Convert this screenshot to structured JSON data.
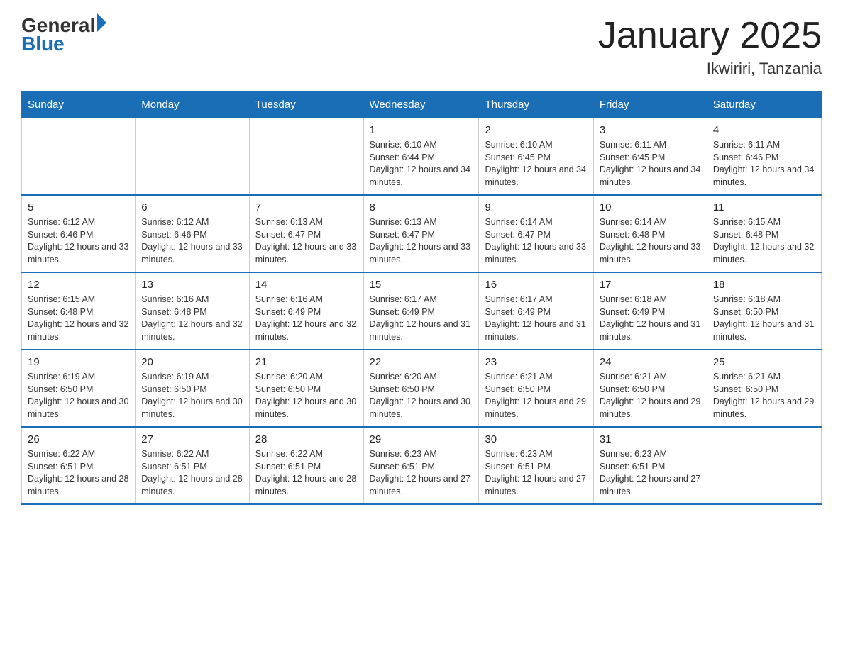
{
  "header": {
    "logo": {
      "general": "General",
      "blue": "Blue"
    },
    "title": "January 2025",
    "subtitle": "Ikwiriri, Tanzania"
  },
  "weekdays": [
    "Sunday",
    "Monday",
    "Tuesday",
    "Wednesday",
    "Thursday",
    "Friday",
    "Saturday"
  ],
  "weeks": [
    [
      {
        "day": "",
        "info": ""
      },
      {
        "day": "",
        "info": ""
      },
      {
        "day": "",
        "info": ""
      },
      {
        "day": "1",
        "info": "Sunrise: 6:10 AM\nSunset: 6:44 PM\nDaylight: 12 hours and 34 minutes."
      },
      {
        "day": "2",
        "info": "Sunrise: 6:10 AM\nSunset: 6:45 PM\nDaylight: 12 hours and 34 minutes."
      },
      {
        "day": "3",
        "info": "Sunrise: 6:11 AM\nSunset: 6:45 PM\nDaylight: 12 hours and 34 minutes."
      },
      {
        "day": "4",
        "info": "Sunrise: 6:11 AM\nSunset: 6:46 PM\nDaylight: 12 hours and 34 minutes."
      }
    ],
    [
      {
        "day": "5",
        "info": "Sunrise: 6:12 AM\nSunset: 6:46 PM\nDaylight: 12 hours and 33 minutes."
      },
      {
        "day": "6",
        "info": "Sunrise: 6:12 AM\nSunset: 6:46 PM\nDaylight: 12 hours and 33 minutes."
      },
      {
        "day": "7",
        "info": "Sunrise: 6:13 AM\nSunset: 6:47 PM\nDaylight: 12 hours and 33 minutes."
      },
      {
        "day": "8",
        "info": "Sunrise: 6:13 AM\nSunset: 6:47 PM\nDaylight: 12 hours and 33 minutes."
      },
      {
        "day": "9",
        "info": "Sunrise: 6:14 AM\nSunset: 6:47 PM\nDaylight: 12 hours and 33 minutes."
      },
      {
        "day": "10",
        "info": "Sunrise: 6:14 AM\nSunset: 6:48 PM\nDaylight: 12 hours and 33 minutes."
      },
      {
        "day": "11",
        "info": "Sunrise: 6:15 AM\nSunset: 6:48 PM\nDaylight: 12 hours and 32 minutes."
      }
    ],
    [
      {
        "day": "12",
        "info": "Sunrise: 6:15 AM\nSunset: 6:48 PM\nDaylight: 12 hours and 32 minutes."
      },
      {
        "day": "13",
        "info": "Sunrise: 6:16 AM\nSunset: 6:48 PM\nDaylight: 12 hours and 32 minutes."
      },
      {
        "day": "14",
        "info": "Sunrise: 6:16 AM\nSunset: 6:49 PM\nDaylight: 12 hours and 32 minutes."
      },
      {
        "day": "15",
        "info": "Sunrise: 6:17 AM\nSunset: 6:49 PM\nDaylight: 12 hours and 31 minutes."
      },
      {
        "day": "16",
        "info": "Sunrise: 6:17 AM\nSunset: 6:49 PM\nDaylight: 12 hours and 31 minutes."
      },
      {
        "day": "17",
        "info": "Sunrise: 6:18 AM\nSunset: 6:49 PM\nDaylight: 12 hours and 31 minutes."
      },
      {
        "day": "18",
        "info": "Sunrise: 6:18 AM\nSunset: 6:50 PM\nDaylight: 12 hours and 31 minutes."
      }
    ],
    [
      {
        "day": "19",
        "info": "Sunrise: 6:19 AM\nSunset: 6:50 PM\nDaylight: 12 hours and 30 minutes."
      },
      {
        "day": "20",
        "info": "Sunrise: 6:19 AM\nSunset: 6:50 PM\nDaylight: 12 hours and 30 minutes."
      },
      {
        "day": "21",
        "info": "Sunrise: 6:20 AM\nSunset: 6:50 PM\nDaylight: 12 hours and 30 minutes."
      },
      {
        "day": "22",
        "info": "Sunrise: 6:20 AM\nSunset: 6:50 PM\nDaylight: 12 hours and 30 minutes."
      },
      {
        "day": "23",
        "info": "Sunrise: 6:21 AM\nSunset: 6:50 PM\nDaylight: 12 hours and 29 minutes."
      },
      {
        "day": "24",
        "info": "Sunrise: 6:21 AM\nSunset: 6:50 PM\nDaylight: 12 hours and 29 minutes."
      },
      {
        "day": "25",
        "info": "Sunrise: 6:21 AM\nSunset: 6:50 PM\nDaylight: 12 hours and 29 minutes."
      }
    ],
    [
      {
        "day": "26",
        "info": "Sunrise: 6:22 AM\nSunset: 6:51 PM\nDaylight: 12 hours and 28 minutes."
      },
      {
        "day": "27",
        "info": "Sunrise: 6:22 AM\nSunset: 6:51 PM\nDaylight: 12 hours and 28 minutes."
      },
      {
        "day": "28",
        "info": "Sunrise: 6:22 AM\nSunset: 6:51 PM\nDaylight: 12 hours and 28 minutes."
      },
      {
        "day": "29",
        "info": "Sunrise: 6:23 AM\nSunset: 6:51 PM\nDaylight: 12 hours and 27 minutes."
      },
      {
        "day": "30",
        "info": "Sunrise: 6:23 AM\nSunset: 6:51 PM\nDaylight: 12 hours and 27 minutes."
      },
      {
        "day": "31",
        "info": "Sunrise: 6:23 AM\nSunset: 6:51 PM\nDaylight: 12 hours and 27 minutes."
      },
      {
        "day": "",
        "info": ""
      }
    ]
  ]
}
